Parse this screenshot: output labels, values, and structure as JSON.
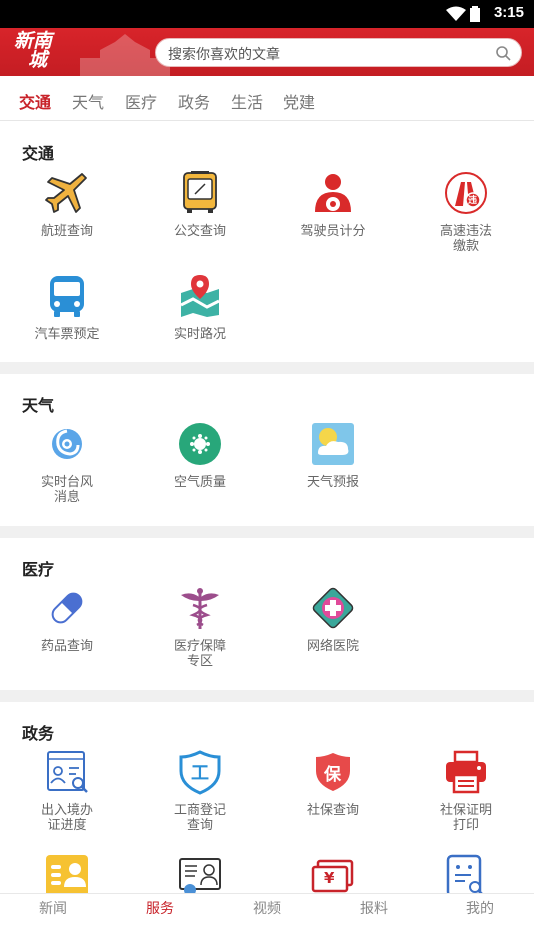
{
  "status_bar": {
    "time": "3:15"
  },
  "header": {
    "logo_line1": "新南",
    "logo_line2": "城",
    "search_placeholder": "搜索你喜欢的文章"
  },
  "tabs": [
    {
      "label": "交通",
      "active": true
    },
    {
      "label": "天气",
      "active": false
    },
    {
      "label": "医疗",
      "active": false
    },
    {
      "label": "政务",
      "active": false
    },
    {
      "label": "生活",
      "active": false
    },
    {
      "label": "党建",
      "active": false
    }
  ],
  "sections": {
    "traffic": {
      "title": "交通",
      "items": [
        {
          "label": "航班查询",
          "icon": "airplane-icon"
        },
        {
          "label": "公交查询",
          "icon": "bus-card-icon"
        },
        {
          "label": "驾驶员计分",
          "icon": "driver-icon"
        },
        {
          "label": "高速违法\n缴款",
          "icon": "violation-icon",
          "badge": "违"
        },
        {
          "label": "汽车票预定",
          "icon": "bus-icon"
        },
        {
          "label": "实时路况",
          "icon": "map-pin-icon"
        }
      ]
    },
    "weather": {
      "title": "天气",
      "items": [
        {
          "label": "实时台风\n消息",
          "icon": "typhoon-icon"
        },
        {
          "label": "空气质量",
          "icon": "air-quality-icon"
        },
        {
          "label": "天气预报",
          "icon": "weather-forecast-icon"
        }
      ]
    },
    "medical": {
      "title": "医疗",
      "items": [
        {
          "label": "药品查询",
          "icon": "pill-icon"
        },
        {
          "label": "医疗保障\n专区",
          "icon": "caduceus-icon"
        },
        {
          "label": "网络医院",
          "icon": "hospital-cross-icon"
        }
      ]
    },
    "government": {
      "title": "政务",
      "items": [
        {
          "label": "出入境办\n证进度",
          "icon": "id-search-icon"
        },
        {
          "label": "工商登记\n查询",
          "icon": "shield-icon",
          "badge": "工"
        },
        {
          "label": "社保查询",
          "icon": "social-security-icon",
          "badge": "保"
        },
        {
          "label": "社保证明\n打印",
          "icon": "printer-icon"
        },
        {
          "label": "",
          "icon": "person-card-icon"
        },
        {
          "label": "",
          "icon": "profile-card-icon"
        },
        {
          "label": "",
          "icon": "yuan-wallet-icon",
          "badge": "¥"
        },
        {
          "label": "",
          "icon": "document-search-icon"
        }
      ]
    }
  },
  "bottom_nav": [
    {
      "label": "新闻",
      "active": false
    },
    {
      "label": "服务",
      "active": true
    },
    {
      "label": "视频",
      "active": false
    },
    {
      "label": "报料",
      "active": false
    },
    {
      "label": "我的",
      "active": false
    }
  ],
  "colors": {
    "brand_red": "#c8232a",
    "icon_orange": "#e8a23a",
    "icon_blue": "#2a8fd6"
  }
}
